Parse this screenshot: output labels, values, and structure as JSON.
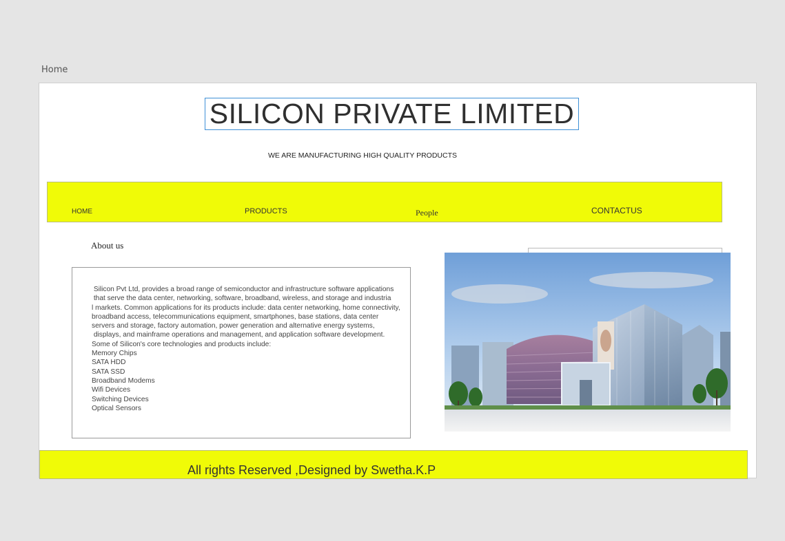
{
  "tab": {
    "label": "Home"
  },
  "header": {
    "title": "SILICON PRIVATE LIMITED",
    "subtitle": "WE ARE MANUFACTURING HIGH QUALITY PRODUCTS"
  },
  "nav": {
    "home": "HOME",
    "products": "PRODUCTS",
    "people": "People",
    "contact": "CONTACTUS"
  },
  "about": {
    "heading": "About us",
    "body": " Silicon Pvt Ltd, provides a broad range of semiconductor and infrastructure software applications\n that serve the data center, networking, software, broadband, wireless, and storage and industria\nl markets. Common applications for its products include: data center networking, home connectivity,\nbroadband access, telecommunications equipment, smartphones, base stations, data center\nservers and storage, factory automation, power generation and alternative energy systems,\n displays, and mainframe operations and management, and application software development.\nSome of Silicon's core technologies and products include:\nMemory Chips\nSATA HDD\nSATA SSD\nBroadband Modems\nWifi Devices\nSwitching Devices\nOptical Sensors"
  },
  "image": {
    "icon": "building-image"
  },
  "footer": {
    "text": "All rights Reserved ,Designed by Swetha.K.P"
  },
  "colors": {
    "background": "#e5e5e5",
    "band": "#f0fb07",
    "title_border": "#3d8fd6"
  }
}
